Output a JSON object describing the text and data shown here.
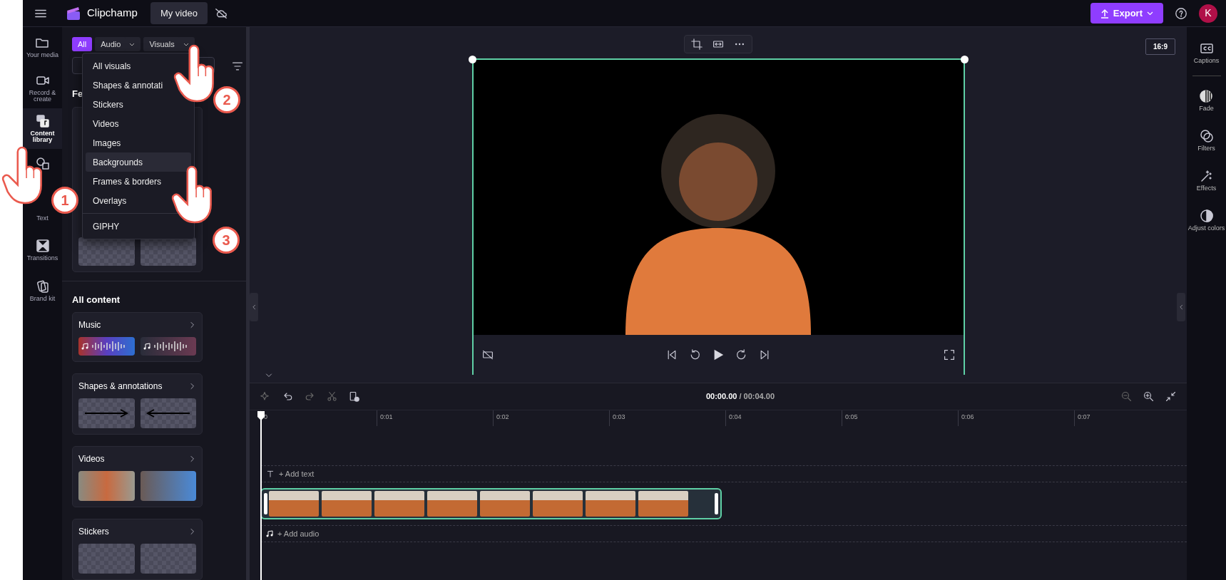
{
  "top_bar": {
    "app_name": "Clipchamp",
    "project_title": "My video",
    "export_label": "Export",
    "avatar_initial": "K"
  },
  "rail": [
    {
      "label": "Your media",
      "selected": false
    },
    {
      "label": "Record & create",
      "selected": false
    },
    {
      "label": "Content library",
      "selected": true
    },
    {
      "selected": false
    },
    {
      "label": "Text",
      "selected": false
    },
    {
      "label": "Transitions",
      "selected": false
    },
    {
      "label": "Brand kit",
      "selected": false
    }
  ],
  "panel": {
    "filters": [
      {
        "label": "All",
        "selected": true,
        "dropdown": false
      },
      {
        "label": "Audio",
        "selected": false,
        "dropdown": true
      },
      {
        "label": "Visuals",
        "selected": false,
        "dropdown": true
      }
    ],
    "featured_heading": "Fe",
    "dropdown": {
      "items": [
        {
          "label": "All visuals",
          "highlighted": false
        },
        {
          "label": "Shapes & annotati",
          "highlighted": false
        },
        {
          "label": "Stickers",
          "highlighted": false
        },
        {
          "label": "Videos",
          "highlighted": false
        },
        {
          "label": "Images",
          "highlighted": false
        },
        {
          "label": "Backgrounds",
          "highlighted": true
        },
        {
          "label": "Frames & borders",
          "highlighted": false
        },
        {
          "label": "Overlays",
          "highlighted": false
        }
      ],
      "footer_item": "GIPHY"
    },
    "all_content_heading": "All content",
    "sections": [
      {
        "title": "Music",
        "kind": "audio"
      },
      {
        "title": "Shapes & annotations",
        "kind": "arrows"
      },
      {
        "title": "Videos",
        "kind": "photos"
      },
      {
        "title": "Stickers",
        "kind": "stickers"
      }
    ]
  },
  "preview": {
    "aspect_ratio": "16:9"
  },
  "right_rail": [
    {
      "label": "Captions"
    },
    {
      "label": "Fade"
    },
    {
      "label": "Filters"
    },
    {
      "label": "Effects"
    },
    {
      "label": "Adjust colors"
    }
  ],
  "timeline": {
    "current_time": "00:00.00",
    "total_time": "/ 00:04.00",
    "ruler": [
      "0",
      "0:01",
      "0:02",
      "0:03",
      "0:04",
      "0:05",
      "0:06",
      "0:07"
    ],
    "text_track": "+ Add text",
    "audio_track": "+ Add audio",
    "clip": {
      "selected": true
    }
  },
  "annotations": [
    {
      "step": "1"
    },
    {
      "step": "2"
    },
    {
      "step": "3"
    }
  ]
}
